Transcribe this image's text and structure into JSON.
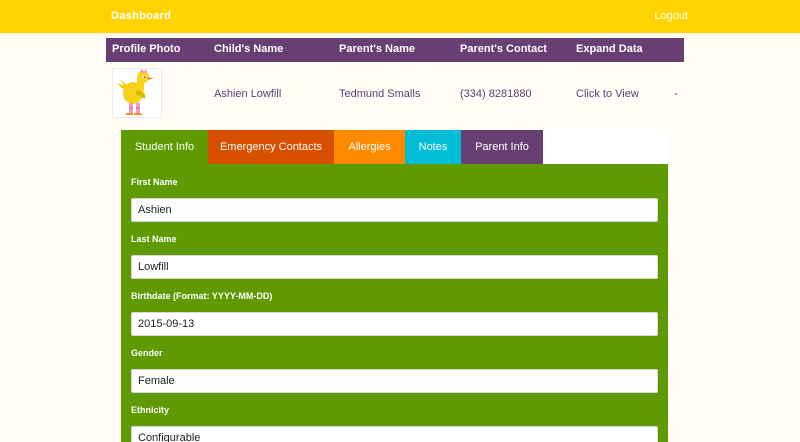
{
  "nav": {
    "dashboard_label": "Dashboard",
    "logout_label": "Logout"
  },
  "table": {
    "headers": [
      "Profile Photo",
      "Child's Name",
      "Parent's Name",
      "Parent's Contact",
      "Expand Data"
    ],
    "row": {
      "child_name": "Ashien Lowfill",
      "parent_name": "Tedmund Smalls",
      "parent_contact": "(334) 8281880",
      "expand_label": "Click to View",
      "extra": "-"
    }
  },
  "tabs": [
    {
      "label": "Student Info",
      "color": "#5f9904"
    },
    {
      "label": "Emergency Contacts",
      "color": "#d94f00"
    },
    {
      "label": "Allergies",
      "color": "#ff8a00"
    },
    {
      "label": "Notes",
      "color": "#00bcd4"
    },
    {
      "label": "Parent Info",
      "color": "#673f73"
    }
  ],
  "form": {
    "first_name": {
      "label": "First Name",
      "value": "Ashien"
    },
    "last_name": {
      "label": "Last Name",
      "value": "Lowfill"
    },
    "birthdate": {
      "label": "Birthdate (Format: YYYY-MM-DD)",
      "value": "2015-09-13"
    },
    "gender": {
      "label": "Gender",
      "value": "Female"
    },
    "ethnicity": {
      "label": "Ethnicity",
      "value": "Configurable"
    }
  },
  "colors": {
    "topbar": "#ffd300",
    "table_header": "#673f73",
    "panel": "#5f9904",
    "row_text": "#5b3f74"
  }
}
